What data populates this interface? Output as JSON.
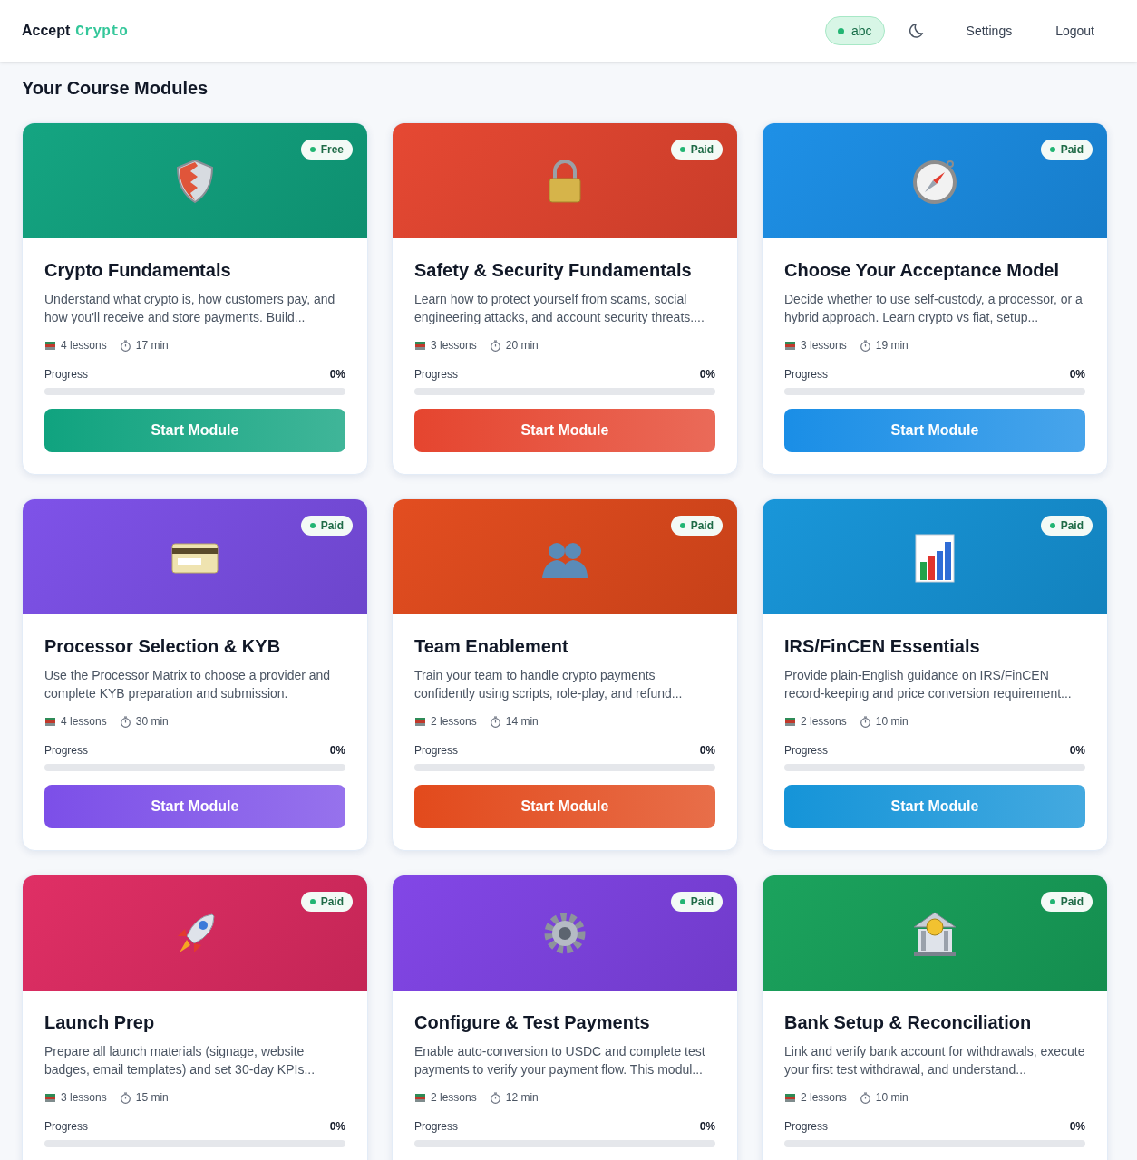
{
  "header": {
    "brand": "Accept",
    "brand_accent": "Crypto",
    "user": "abc",
    "links": [
      "Settings",
      "Logout"
    ]
  },
  "page_title": "Your Course Modules",
  "modules": [
    {
      "title": "Crypto Fundamentals",
      "color": "#10a37f",
      "badge": "Free",
      "description": "Understand what crypto is, how customers pay, and how you'll receive and store payments. Build...",
      "lessons": "4 lessons",
      "duration": "17 min",
      "progress_label": "Progress",
      "progress_value": "0%",
      "button": "Start Module"
    },
    {
      "title": "Safety & Security Fundamentals",
      "color": "#e5452f",
      "badge": "Paid",
      "description": "Learn how to protect yourself from scams, social engineering attacks, and account security threats....",
      "lessons": "3 lessons",
      "duration": "20 min",
      "progress_label": "Progress",
      "progress_value": "0%",
      "button": "Start Module"
    },
    {
      "title": "Choose Your Acceptance Model",
      "color": "#1a8ee6",
      "badge": "Paid",
      "description": "Decide whether to use self-custody, a processor, or a hybrid approach. Learn crypto vs fiat, setup...",
      "lessons": "3 lessons",
      "duration": "19 min",
      "progress_label": "Progress",
      "progress_value": "0%",
      "button": "Start Module"
    },
    {
      "title": "Processor Selection & KYB",
      "color": "#7c4fe8",
      "badge": "Paid",
      "description": "Use the Processor Matrix to choose a provider and complete KYB preparation and submission.",
      "lessons": "4 lessons",
      "duration": "30 min",
      "progress_label": "Progress",
      "progress_value": "0%",
      "button": "Start Module"
    },
    {
      "title": "Team Enablement",
      "color": "#e24a1c",
      "badge": "Paid",
      "description": "Train your team to handle crypto payments confidently using scripts, role-play, and refund...",
      "lessons": "2 lessons",
      "duration": "14 min",
      "progress_label": "Progress",
      "progress_value": "0%",
      "button": "Start Module"
    },
    {
      "title": "IRS/FinCEN Essentials",
      "color": "#1594d8",
      "badge": "Paid",
      "description": "Provide plain-English guidance on IRS/FinCEN record-keeping and price conversion requirement...",
      "lessons": "2 lessons",
      "duration": "10 min",
      "progress_label": "Progress",
      "progress_value": "0%",
      "button": "Start Module"
    },
    {
      "title": "Launch Prep",
      "color": "#df2b62",
      "badge": "Paid",
      "description": "Prepare all launch materials (signage, website badges, email templates) and set 30-day KPIs...",
      "lessons": "3 lessons",
      "duration": "15 min",
      "progress_label": "Progress",
      "progress_value": "0%"
    },
    {
      "title": "Configure & Test Payments",
      "color": "#8043e6",
      "badge": "Paid",
      "description": "Enable auto-conversion to USDC and complete test payments to verify your payment flow. This modul...",
      "lessons": "2 lessons",
      "duration": "12 min",
      "progress_label": "Progress",
      "progress_value": "0%"
    },
    {
      "title": "Bank Setup & Reconciliation",
      "color": "#17a15a",
      "badge": "Paid",
      "description": "Link and verify bank account for withdrawals, execute your first test withdrawal, and understand...",
      "lessons": "2 lessons",
      "duration": "10 min",
      "progress_label": "Progress",
      "progress_value": "0%"
    }
  ]
}
